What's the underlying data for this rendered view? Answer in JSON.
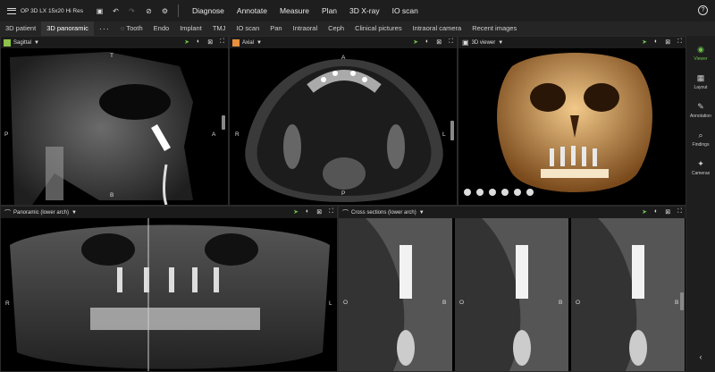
{
  "app": {
    "device": "OP 3D LX 15x20 Hi Res"
  },
  "menu": [
    "Diagnose",
    "Annotate",
    "Measure",
    "Plan",
    "3D X-ray",
    "IO scan"
  ],
  "tabs": [
    "3D patient",
    "3D panoramic",
    "···",
    "Tooth",
    "Endo",
    "Implant",
    "TMJ",
    "IO scan",
    "Pan",
    "Intraoral",
    "Ceph",
    "Clinical pictures",
    "Intraoral camera",
    "Recent images"
  ],
  "viewports": {
    "sagittal": {
      "title": "Sagittal",
      "color": "#8fc24a",
      "labels": {
        "top": "T",
        "left": "P",
        "right": "A",
        "bottom": "B"
      }
    },
    "axial": {
      "title": "Axial",
      "color": "#e8903c",
      "labels": {
        "top": "A",
        "left": "R",
        "right": "L",
        "bottom": "P"
      }
    },
    "viewer3d": {
      "title": "3D viewer"
    },
    "panoramic": {
      "title": "Panoramic (lower arch)",
      "labels": {
        "left": "R",
        "right": "L"
      }
    },
    "cross": {
      "title": "Cross sections (lower arch)",
      "labels": {
        "o": "O",
        "b": "B"
      }
    }
  },
  "sidebar": [
    {
      "label": "Viewer",
      "icon": "eye-icon"
    },
    {
      "label": "Layout",
      "icon": "layout-icon"
    },
    {
      "label": "Annotation",
      "icon": "pencil-icon"
    },
    {
      "label": "Findings",
      "icon": "findings-icon"
    },
    {
      "label": "Cameras",
      "icon": "camera-icon"
    }
  ],
  "colors": {
    "accent": "#6ec14b"
  }
}
